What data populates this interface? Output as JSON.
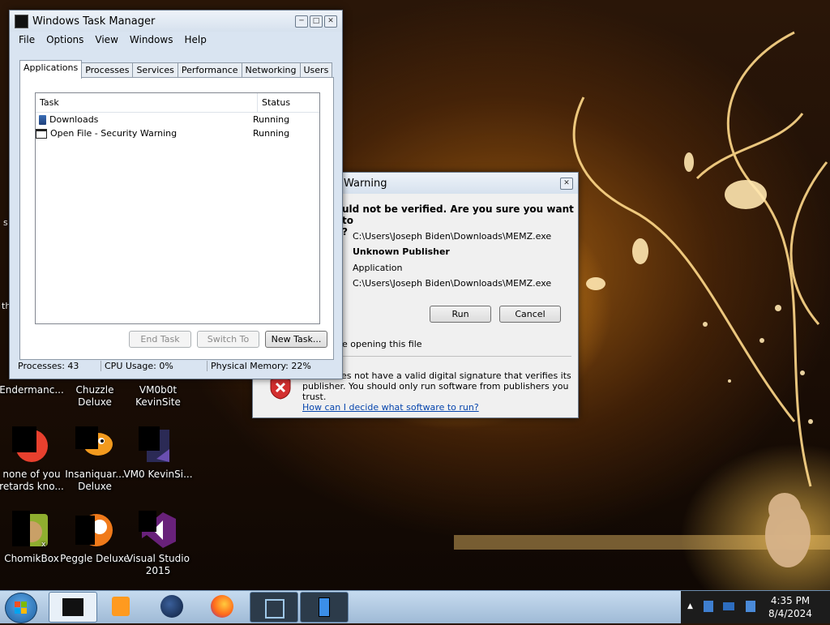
{
  "desktop": {
    "icons": [
      {
        "label": "Endermanc..."
      },
      {
        "label": "Chuzzle Deluxe"
      },
      {
        "label": "VM0b0t KevinSite"
      },
      {
        "label": "none of you retards kno..."
      },
      {
        "label": "Insaniquar... Deluxe"
      },
      {
        "label": "VM0 KevinSi..."
      },
      {
        "label": "ChomikBox"
      },
      {
        "label": "Peggle Deluxe"
      },
      {
        "label": "Visual Studio 2015"
      }
    ],
    "edge_text": {
      "a": "s",
      "b": "th"
    }
  },
  "task_manager": {
    "title": "Windows Task Manager",
    "menu": [
      "File",
      "Options",
      "View",
      "Windows",
      "Help"
    ],
    "tabs": [
      "Applications",
      "Processes",
      "Services",
      "Performance",
      "Networking",
      "Users"
    ],
    "columns": {
      "task": "Task",
      "status": "Status"
    },
    "rows": [
      {
        "task": "Downloads",
        "status": "Running",
        "icon": "folder-icon"
      },
      {
        "task": "Open File - Security Warning",
        "status": "Running",
        "icon": "window-icon"
      }
    ],
    "buttons": {
      "end_task": "End Task",
      "switch_to": "Switch To",
      "new_task": "New Task..."
    },
    "status": {
      "processes": "Processes: 43",
      "cpu": "CPU Usage: 0%",
      "memory": "Physical Memory: 22%"
    }
  },
  "security_warning": {
    "title_visible": "Warning",
    "heading_line1": "uld not be verified.  Are you sure you want to",
    "heading_line2": "?",
    "fields": [
      {
        "value": "C:\\Users\\Joseph Biden\\Downloads\\MEMZ.exe",
        "bold": false
      },
      {
        "value": "Unknown Publisher",
        "bold": true
      },
      {
        "value": "Application",
        "bold": false
      },
      {
        "value": "C:\\Users\\Joseph Biden\\Downloads\\MEMZ.exe",
        "bold": false
      }
    ],
    "buttons": {
      "run": "Run",
      "cancel": "Cancel"
    },
    "checkbox_label": "e opening this file",
    "warning_text_line1": "es not have a valid digital signature that verifies its",
    "warning_text_line2": "publisher.  You should only run software from publishers you trust.",
    "link": "How can I decide what software to run?"
  },
  "taskbar": {
    "clock_time": "4:35 PM",
    "clock_date": "8/4/2024"
  },
  "colors": {
    "taskbar_bg": "#a8c4e0",
    "link": "#0645ad",
    "error_red": "#d32f2f"
  }
}
